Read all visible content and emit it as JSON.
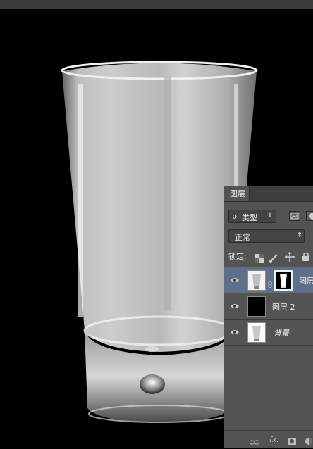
{
  "panel": {
    "tab_label": "图层",
    "filter": {
      "search_glyph": "ρ",
      "label": "类型",
      "arrows": "⇕"
    },
    "blend_mode": {
      "value": "正常",
      "arrows": "⇕"
    },
    "lock": {
      "label": "锁定:"
    },
    "layers": [
      {
        "name": "图层",
        "selected": true,
        "visible": true,
        "thumb": "glass-white",
        "mask": "black-with-white-glass"
      },
      {
        "name": "图层 2",
        "selected": false,
        "visible": true,
        "thumb": "black"
      },
      {
        "name": "背景",
        "selected": false,
        "visible": true,
        "thumb": "glass-white",
        "italic": true
      }
    ],
    "bottom_icons": [
      "link-icon",
      "fx-icon",
      "mask-icon",
      "adjustment-icon"
    ],
    "bottom_fx_label": "fx."
  },
  "colors": {
    "canvas_bg": "#000000",
    "panel_bg": "#535353",
    "selection": "#5f6f8a"
  }
}
